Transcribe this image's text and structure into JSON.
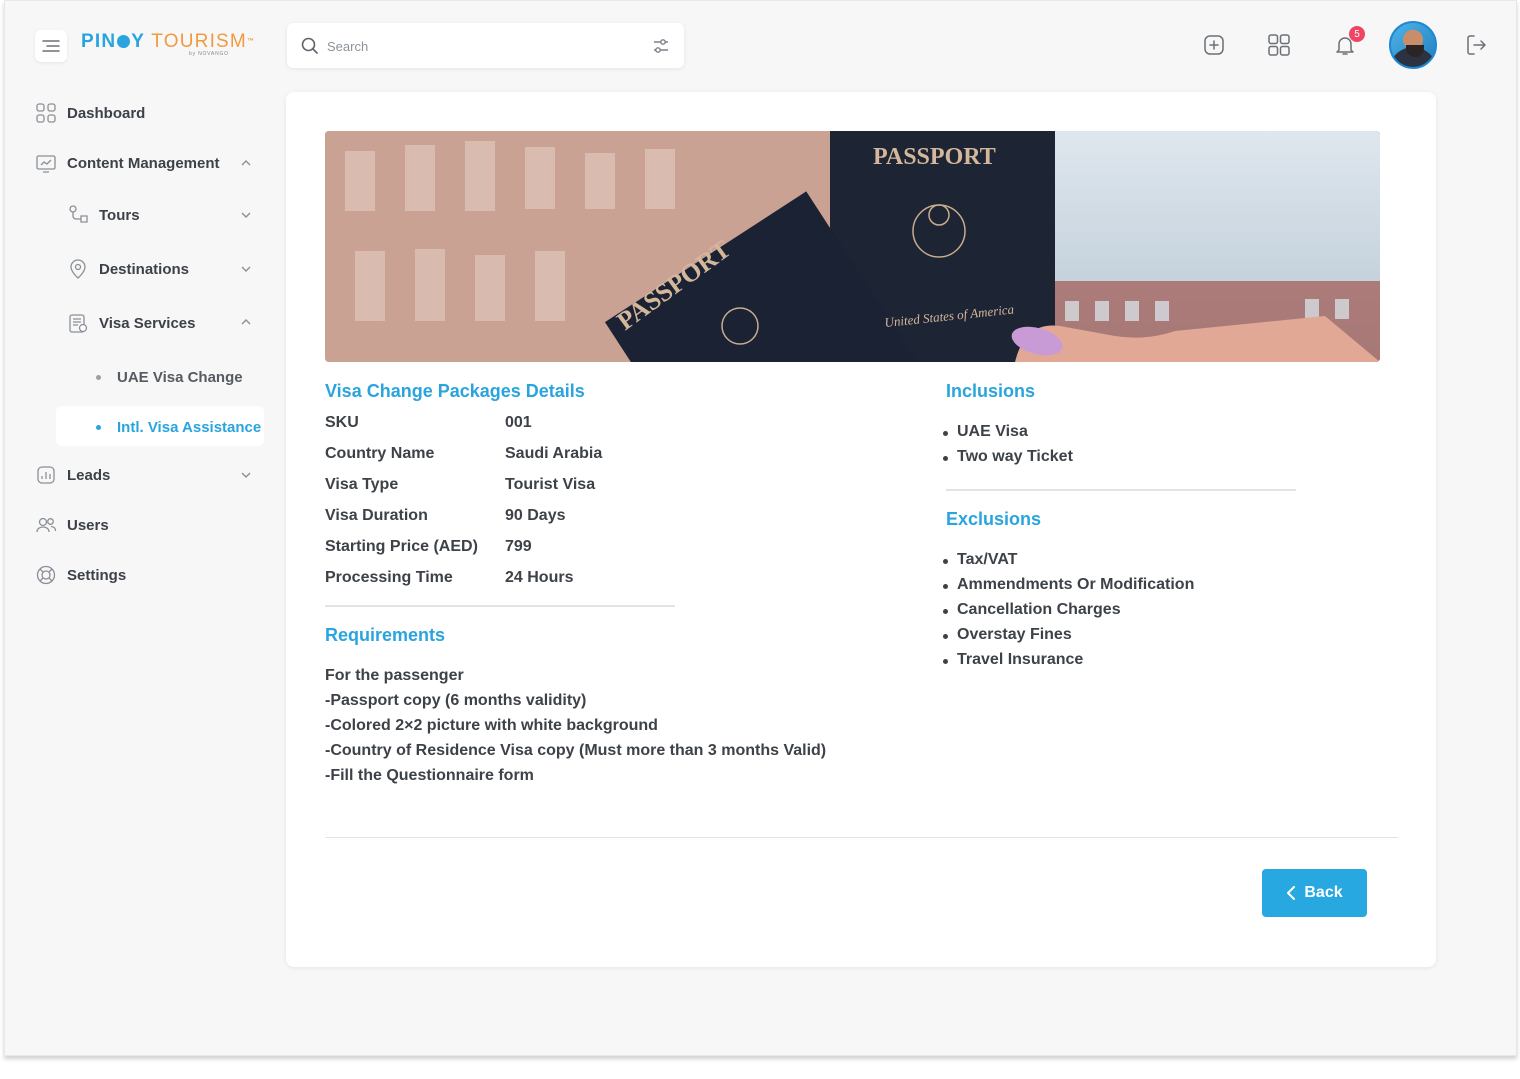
{
  "brand": {
    "name_part1": "PIN",
    "name_part2": "Y",
    "name_part3": "TOURISM",
    "trademark": "™",
    "byline": "by NOVANGO"
  },
  "search": {
    "placeholder": "Search"
  },
  "notifications": {
    "count": "5"
  },
  "sidebar": {
    "items": [
      {
        "label": "Dashboard",
        "icon": "grid-icon"
      },
      {
        "label": "Content Management",
        "icon": "content-icon",
        "expanded": true
      },
      {
        "label": "Tours",
        "icon": "route-icon"
      },
      {
        "label": "Destinations",
        "icon": "location-pin-icon"
      },
      {
        "label": "Visa Services",
        "icon": "visa-document-icon",
        "expanded": true
      },
      {
        "label": "Leads",
        "icon": "chart-doc-icon"
      },
      {
        "label": "Users",
        "icon": "users-icon"
      },
      {
        "label": "Settings",
        "icon": "lifebuoy-icon"
      }
    ],
    "sub_items": [
      {
        "label": "UAE Visa Change"
      },
      {
        "label": "Intl. Visa Assistance",
        "active": true
      }
    ]
  },
  "details": {
    "title": "Visa Change Packages Details",
    "rows": [
      {
        "label": "SKU",
        "value": "001"
      },
      {
        "label": "Country Name",
        "value": "Saudi Arabia"
      },
      {
        "label": "Visa Type",
        "value": "Tourist Visa"
      },
      {
        "label": "Visa Duration",
        "value": "90 Days"
      },
      {
        "label": "Starting Price (AED)",
        "value": "799"
      },
      {
        "label": "Processing Time",
        "value": "24 Hours"
      }
    ]
  },
  "requirements": {
    "title": "Requirements",
    "lines": [
      "For the passenger",
      "-Passport copy (6 months validity)",
      "-Colored 2×2 picture with white background",
      "-Country of Residence Visa copy (Must more than 3 months Valid)",
      "-Fill the Questionnaire form"
    ]
  },
  "inclusions": {
    "title": "Inclusions",
    "items": [
      "UAE Visa",
      "Two way Ticket"
    ]
  },
  "exclusions": {
    "title": "Exclusions",
    "items": [
      "Tax/VAT",
      "Ammendments Or Modification",
      "Cancellation Charges",
      "Overstay Fines",
      "Travel Insurance"
    ]
  },
  "banner": {
    "text_left": "PASSPORT",
    "text_right": "PASSPORT",
    "text_small": "United States of America"
  },
  "actions": {
    "back_label": "Back"
  },
  "colors": {
    "accent": "#2aa4df",
    "brand_orange": "#f19a3e",
    "badge": "#ef4565"
  }
}
